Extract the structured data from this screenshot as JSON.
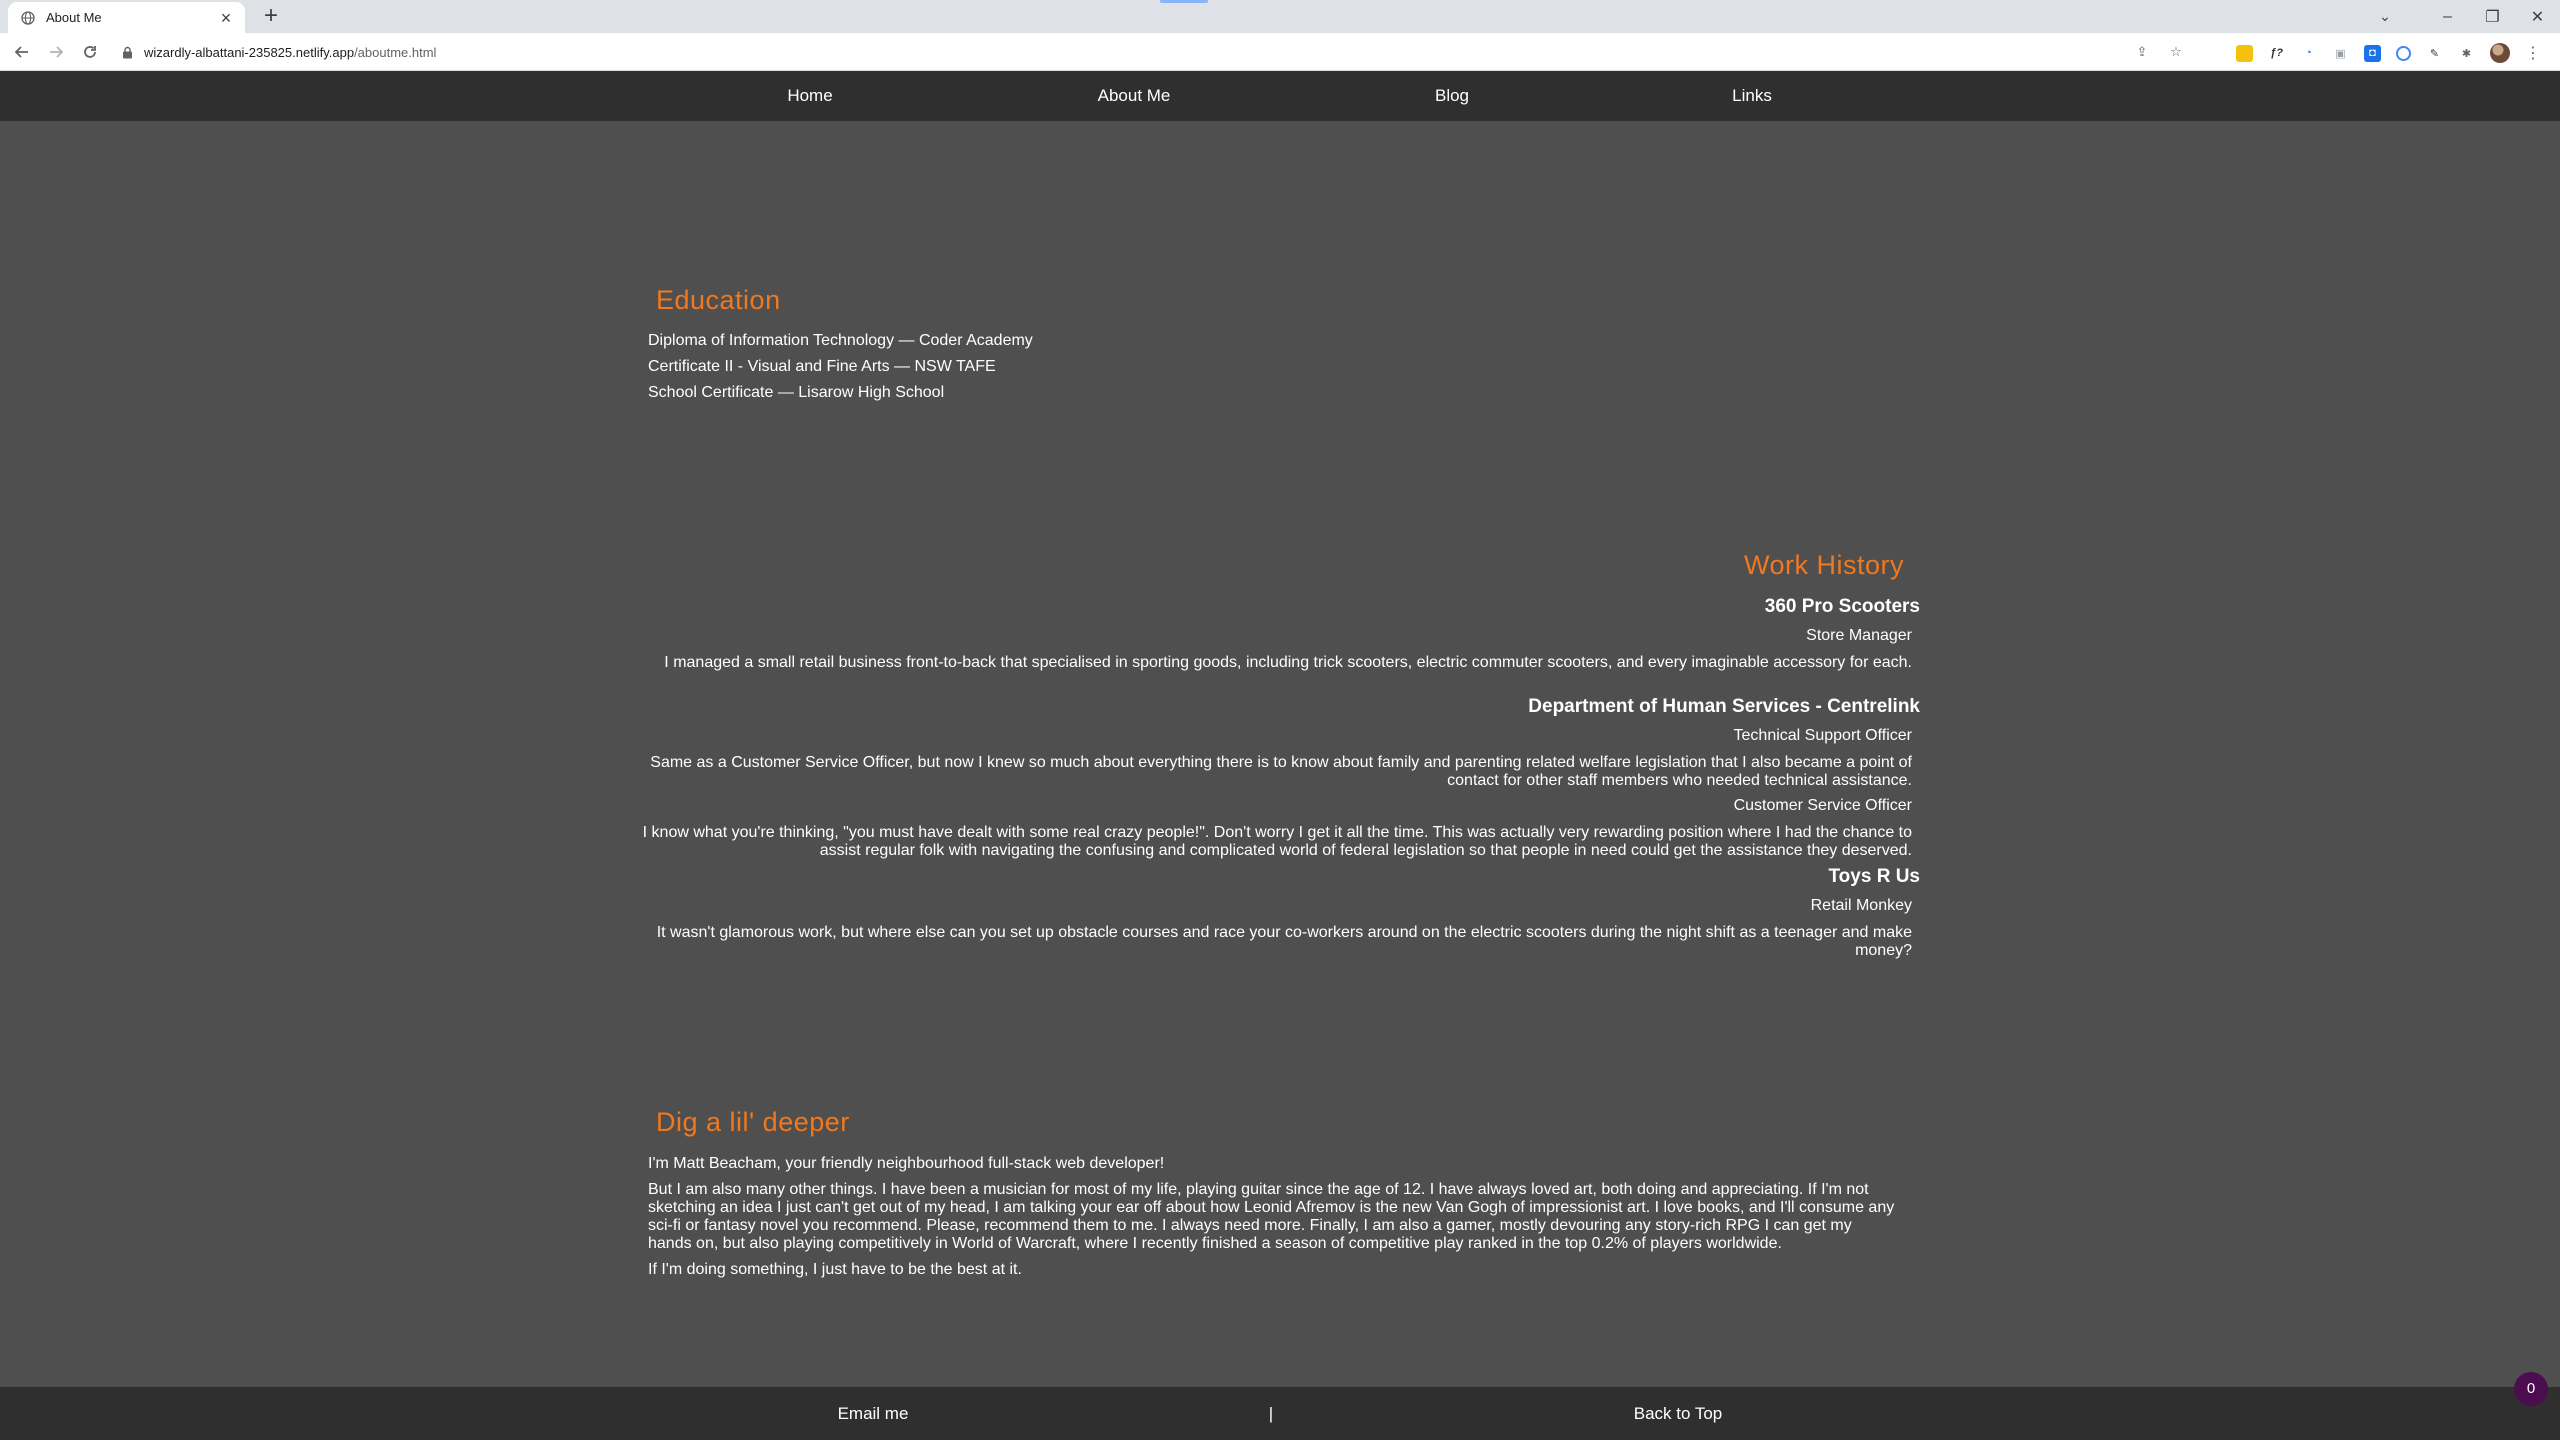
{
  "browser": {
    "tab_title": "About Me",
    "url_host": "wizardly-albattani-235825.netlify.app",
    "url_path": "/aboutme.html",
    "icons": [
      "globe-icon",
      "close-icon",
      "plus-icon",
      "back-icon",
      "forward-icon",
      "reload-icon",
      "lock-icon",
      "share-icon",
      "star-icon",
      "extensions-icon",
      "menu-icon"
    ]
  },
  "nav": {
    "items": [
      {
        "label": "Home"
      },
      {
        "label": "About Me"
      },
      {
        "label": "Blog"
      },
      {
        "label": "Links"
      }
    ]
  },
  "education": {
    "title": "Education",
    "items": [
      "Diploma of Information Technology — Coder Academy",
      "Certificate II - Visual and Fine Arts — NSW TAFE",
      "School Certificate — Lisarow High School"
    ]
  },
  "work": {
    "title": "Work History",
    "employers": [
      {
        "name": "360 Pro Scooters",
        "roles": [
          {
            "title": "Store Manager",
            "desc": "I managed a small retail business front-to-back that specialised in sporting goods, including trick scooters, electric commuter scooters, and every imaginable accessory for each."
          }
        ]
      },
      {
        "name": "Department of Human Services - Centrelink",
        "roles": [
          {
            "title": "Technical Support Officer",
            "desc": "Same as a Customer Service Officer, but now I knew so much about everything there is to know about family and parenting related welfare legislation that I also became a point of contact for other staff members who needed technical assistance."
          },
          {
            "title": "Customer Service Officer",
            "desc": "I know what you're thinking, \"you must have dealt with some real crazy people!\". Don't worry I get it all the time. This was actually very rewarding position where I had the chance to assist regular folk with navigating the confusing and complicated world of federal legislation so that people in need could get the assistance they deserved."
          }
        ]
      },
      {
        "name": "Toys R Us",
        "roles": [
          {
            "title": "Retail Monkey",
            "desc": "It wasn't glamorous work, but where else can you set up obstacle courses and race your co-workers around on the electric scooters during the night shift as a teenager and make money?"
          }
        ]
      }
    ]
  },
  "deeper": {
    "title": "Dig a lil' deeper",
    "paragraphs": [
      "I'm Matt Beacham, your friendly neighbourhood full-stack web developer!",
      "But I am also many other things. I have been a musician for most of my life, playing guitar since the age of 12. I have always loved art, both doing and appreciating. If I'm not sketching an idea I just can't get out of my head, I am talking your ear off about how Leonid Afremov is the new Van Gogh of impressionist art. I love books, and I'll consume any sci-fi or fantasy novel you recommend. Please, recommend them to me. I always need more. Finally, I am also a gamer, mostly devouring any story-rich RPG I can get my hands on, but also playing competitively in World of Warcraft, where I recently finished a season of competitive play ranked in the top 0.2% of players worldwide.",
      "If I'm doing something, I just have to be the best at it."
    ]
  },
  "footer": {
    "email": "Email me",
    "separator": "|",
    "back_to_top": "Back to Top"
  },
  "badge": {
    "count": "0"
  },
  "colors": {
    "accent": "#f0781e",
    "background": "#4f4f4f",
    "bar": "#2f2f2f"
  }
}
